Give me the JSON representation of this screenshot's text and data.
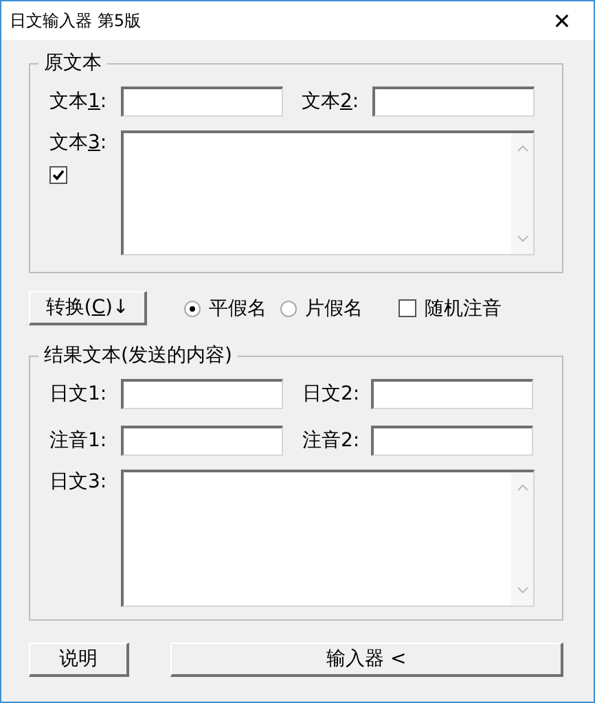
{
  "window": {
    "title": "日文输入器 第5版",
    "close": "✕"
  },
  "source_group": {
    "title": "原文本",
    "fields": [
      {
        "label": "文本",
        "key": "1",
        "suffix": ":"
      },
      {
        "label": "文本",
        "key": "2",
        "suffix": ":"
      }
    ],
    "text3": {
      "label": "文本",
      "key": "3",
      "suffix": ":",
      "checked": true
    }
  },
  "convert_button": {
    "label": "转换(",
    "key": "C",
    "suffix": ")↓"
  },
  "options": [
    {
      "kind": "radio",
      "label": "平假名",
      "selected": true
    },
    {
      "kind": "radio",
      "label": "片假名",
      "selected": false
    },
    {
      "kind": "checkbox",
      "label": "随机注音",
      "checked": false
    }
  ],
  "result_group": {
    "title": "结果文本(发送的内容)",
    "fields": [
      {
        "label": "日文1:"
      },
      {
        "label": "日文2:"
      },
      {
        "label": "注音1:"
      },
      {
        "label": "注音2:"
      }
    ],
    "text3": {
      "label": "日文3:"
    }
  },
  "buttons": [
    {
      "label": "说明"
    },
    {
      "label": "输入器 <"
    }
  ]
}
